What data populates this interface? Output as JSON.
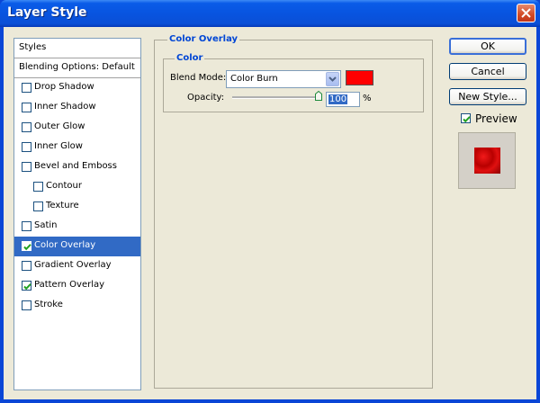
{
  "window": {
    "title": "Layer Style"
  },
  "styles_list": {
    "header": "Styles",
    "blending": "Blending Options: Default",
    "items": [
      {
        "label": "Drop Shadow",
        "checked": false,
        "indent": false
      },
      {
        "label": "Inner Shadow",
        "checked": false,
        "indent": false
      },
      {
        "label": "Outer Glow",
        "checked": false,
        "indent": false
      },
      {
        "label": "Inner Glow",
        "checked": false,
        "indent": false
      },
      {
        "label": "Bevel and Emboss",
        "checked": false,
        "indent": false
      },
      {
        "label": "Contour",
        "checked": false,
        "indent": true
      },
      {
        "label": "Texture",
        "checked": false,
        "indent": true
      },
      {
        "label": "Satin",
        "checked": false,
        "indent": false
      },
      {
        "label": "Color Overlay",
        "checked": true,
        "indent": false,
        "selected": true
      },
      {
        "label": "Gradient Overlay",
        "checked": false,
        "indent": false
      },
      {
        "label": "Pattern Overlay",
        "checked": true,
        "indent": false
      },
      {
        "label": "Stroke",
        "checked": false,
        "indent": false
      }
    ]
  },
  "panel": {
    "section_title": "Color Overlay",
    "group_title": "Color",
    "blend_mode_label": "Blend Mode:",
    "blend_mode_value": "Color Burn",
    "overlay_color": "#ff0000",
    "opacity_label": "Opacity:",
    "opacity_value": "100",
    "opacity_unit": "%"
  },
  "buttons": {
    "ok": "OK",
    "cancel": "Cancel",
    "new_style": "New Style..."
  },
  "preview": {
    "label": "Preview",
    "checked": true
  }
}
